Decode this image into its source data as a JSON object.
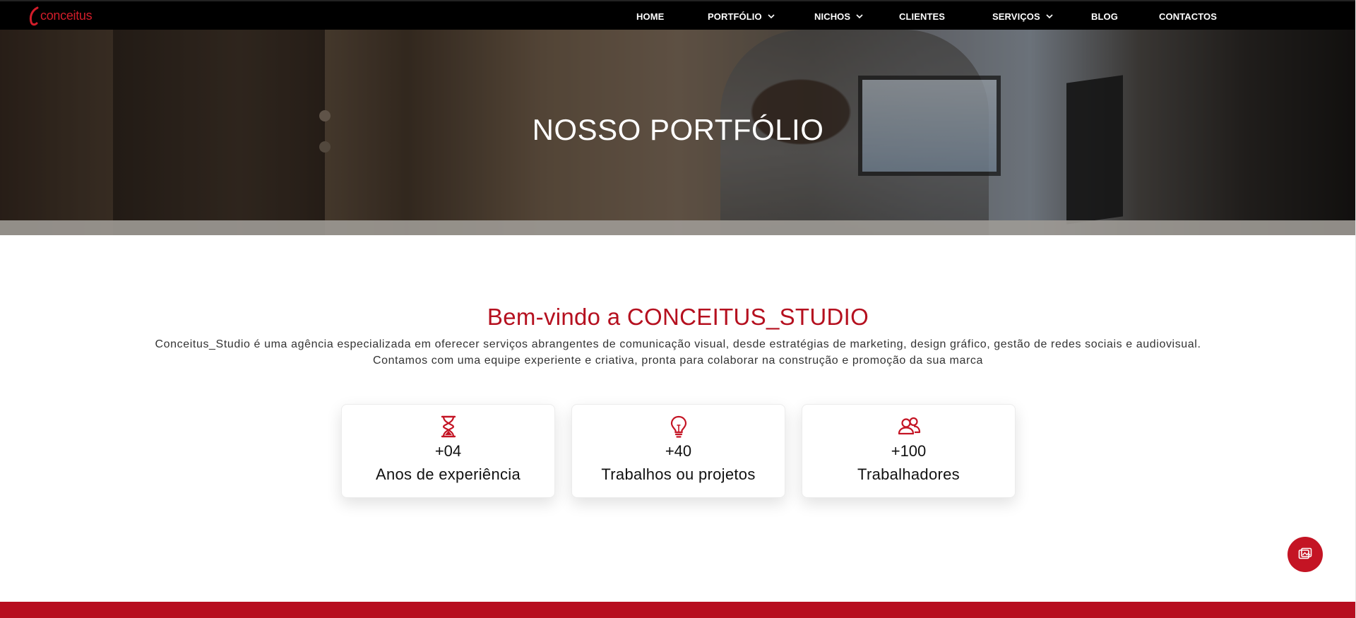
{
  "brand": {
    "logo_text": "conceitus",
    "accent": "#c41424",
    "dark": "#000000"
  },
  "nav": {
    "items": [
      {
        "label": "HOME",
        "dropdown": false
      },
      {
        "label": "PORTFÓLIO",
        "dropdown": true
      },
      {
        "label": "NICHOS",
        "dropdown": true
      },
      {
        "label": "CLIENTES",
        "dropdown": false
      },
      {
        "label": "SERVIÇOS",
        "dropdown": true
      },
      {
        "label": "BLOG",
        "dropdown": false
      },
      {
        "label": "CONTACTOS",
        "dropdown": false
      }
    ]
  },
  "hero": {
    "title": "NOSSO PORTFÓLIO"
  },
  "intro": {
    "title": "Bem-vindo a CONCEITUS_STUDIO",
    "line1": "Conceitus_Studio é uma agência especializada em oferecer serviços abrangentes de comunicação visual, desde estratégias de marketing, design gráfico, gestão de redes sociais e audiovisual.",
    "line2": "Contamos com uma equipe experiente e criativa, pronta para colaborar na construção e promoção da sua marca"
  },
  "stats": [
    {
      "icon": "hourglass-icon",
      "value": "+04",
      "label": "Anos de experiência"
    },
    {
      "icon": "lightbulb-icon",
      "value": "+40",
      "label": "Trabalhos ou projetos"
    },
    {
      "icon": "users-icon",
      "value": "+100",
      "label": "Trabalhadores"
    }
  ],
  "fab": {
    "icon": "gallery-icon"
  }
}
